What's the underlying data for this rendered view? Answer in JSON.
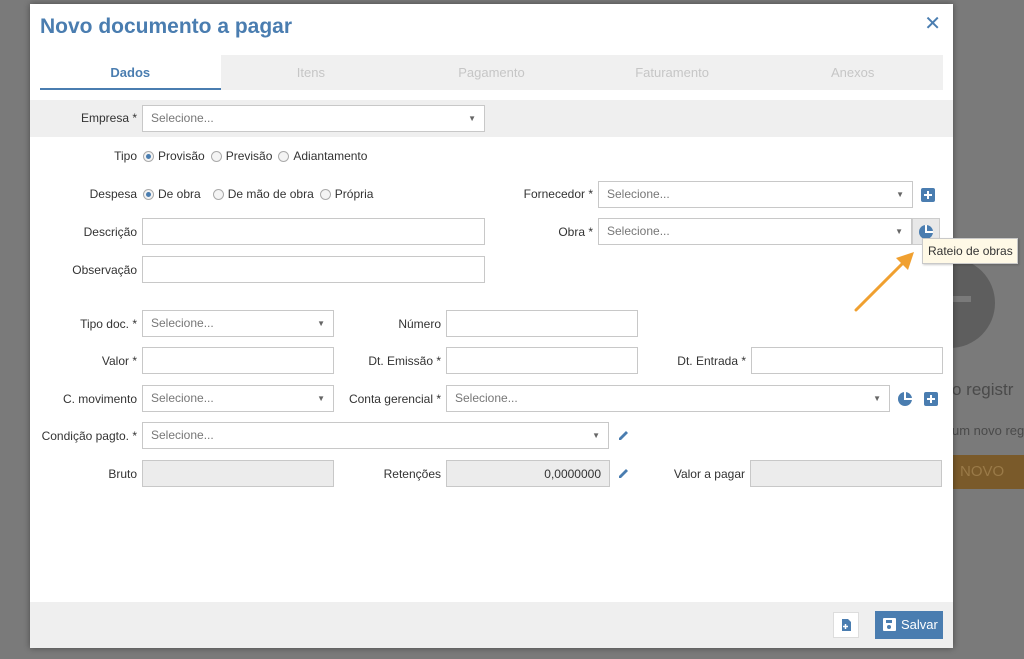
{
  "background": {
    "text_registro": "o registr",
    "text_novo_reg": "um novo reg",
    "btn_novo": "NOVO"
  },
  "modal": {
    "title": "Novo documento a pagar",
    "close_glyph": "✕"
  },
  "tabs": [
    {
      "label": "Dados"
    },
    {
      "label": "Itens"
    },
    {
      "label": "Pagamento"
    },
    {
      "label": "Faturamento"
    },
    {
      "label": "Anexos"
    }
  ],
  "form": {
    "empresa": {
      "label": "Empresa *",
      "placeholder": "Selecione..."
    },
    "tipo": {
      "label": "Tipo",
      "options": [
        "Provisão",
        "Previsão",
        "Adiantamento"
      ],
      "selected": "Provisão"
    },
    "despesa": {
      "label": "Despesa",
      "options": [
        "De obra",
        "De mão de obra",
        "Própria"
      ],
      "selected": "De obra"
    },
    "fornecedor": {
      "label": "Fornecedor *",
      "placeholder": "Selecione..."
    },
    "descricao": {
      "label": "Descrição",
      "value": ""
    },
    "obra": {
      "label": "Obra *",
      "placeholder": "Selecione..."
    },
    "observacao": {
      "label": "Observação",
      "value": ""
    },
    "tipo_doc": {
      "label": "Tipo doc. *",
      "placeholder": "Selecione..."
    },
    "numero": {
      "label": "Número",
      "value": ""
    },
    "valor": {
      "label": "Valor *",
      "value": ""
    },
    "dt_emissao": {
      "label": "Dt. Emissão *",
      "value": ""
    },
    "dt_entrada": {
      "label": "Dt. Entrada *",
      "value": ""
    },
    "c_movimento": {
      "label": "C. movimento",
      "placeholder": "Selecione..."
    },
    "conta_gerencial": {
      "label": "Conta gerencial *",
      "placeholder": "Selecione..."
    },
    "condicao_pagto": {
      "label": "Condição pagto. *",
      "placeholder": "Selecione..."
    },
    "bruto": {
      "label": "Bruto",
      "value": ""
    },
    "retencoes": {
      "label": "Retenções",
      "value": "0,0000000"
    },
    "valor_pagar": {
      "label": "Valor a pagar",
      "value": ""
    }
  },
  "tooltip": {
    "text": "Rateio de obras"
  },
  "footer": {
    "save_label": "Salvar"
  },
  "colors": {
    "accent": "#4a7db0",
    "arrow": "#f0a030"
  }
}
